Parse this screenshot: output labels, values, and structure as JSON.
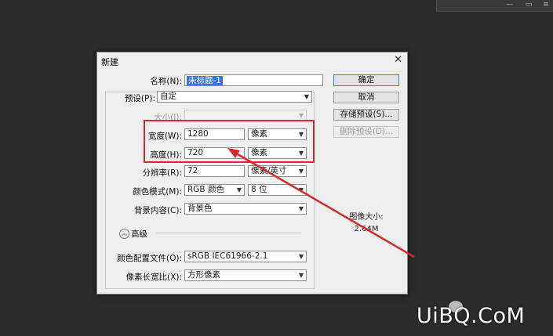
{
  "dialog": {
    "title": "新建",
    "close_glyph": "✕",
    "name": {
      "label": "名称(N):",
      "value": "未标题-1"
    },
    "preset": {
      "label": "预设(P):",
      "value": "自定"
    },
    "size": {
      "label": "大小(I):",
      "value": ""
    },
    "width": {
      "label": "宽度(W):",
      "value": "1280",
      "unit": "像素"
    },
    "height": {
      "label": "高度(H):",
      "value": "720",
      "unit": "像素"
    },
    "resolution": {
      "label": "分辨率(R):",
      "value": "72",
      "unit": "像素/英寸"
    },
    "color_mode": {
      "label": "颜色模式(M):",
      "mode": "RGB 颜色",
      "depth": "8 位"
    },
    "background": {
      "label": "背景内容(C):",
      "value": "背景色"
    },
    "advanced": {
      "label": "高级"
    },
    "color_profile": {
      "label": "颜色配置文件(O):",
      "value": "sRGB IEC61966-2.1"
    },
    "pixel_aspect": {
      "label": "像素长宽比(X):",
      "value": "方形像素"
    },
    "buttons": {
      "ok": "确定",
      "cancel": "取消",
      "save_preset": "存储预设(S)...",
      "delete_preset": "删除预设(D)..."
    },
    "image_size": {
      "label": "图像大小:",
      "value": "2.64M"
    }
  },
  "icons": {
    "chevron": "chevron-down-icon",
    "advanced": "chevron-up-circle-icon",
    "close": "close-icon"
  },
  "colors": {
    "annotation": "#d42a2a",
    "selection": "#3875d6"
  },
  "watermark": {
    "text": "UiBQ.CoM"
  }
}
